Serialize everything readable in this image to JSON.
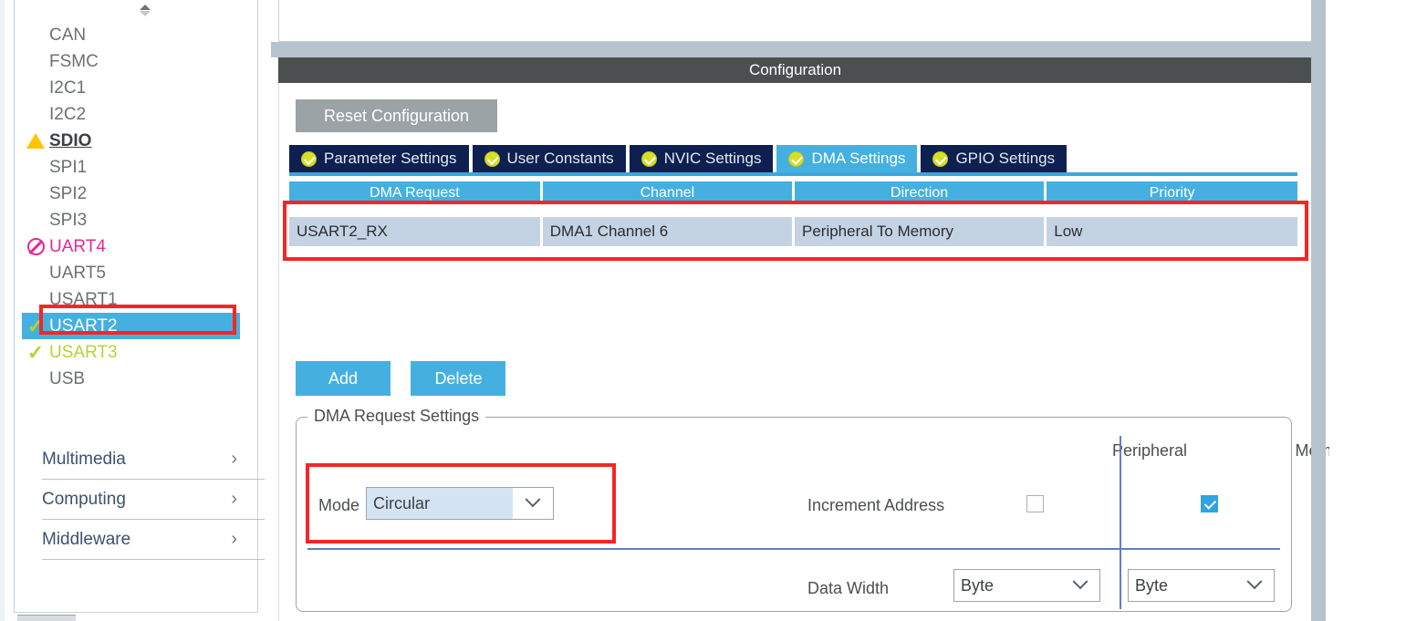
{
  "sidebar": {
    "scroll_spinner": "up-down-spinner",
    "peripherals": [
      {
        "label": "CAN",
        "icon": "none",
        "state": "normal"
      },
      {
        "label": "FSMC",
        "icon": "none",
        "state": "normal"
      },
      {
        "label": "I2C1",
        "icon": "none",
        "state": "normal"
      },
      {
        "label": "I2C2",
        "icon": "none",
        "state": "normal"
      },
      {
        "label": "SDIO",
        "icon": "warning-triangle-icon",
        "state": "warn"
      },
      {
        "label": "SPI1",
        "icon": "none",
        "state": "normal"
      },
      {
        "label": "SPI2",
        "icon": "none",
        "state": "normal"
      },
      {
        "label": "SPI3",
        "icon": "none",
        "state": "normal"
      },
      {
        "label": "UART4",
        "icon": "forbidden-icon",
        "state": "disabled"
      },
      {
        "label": "UART5",
        "icon": "none",
        "state": "normal"
      },
      {
        "label": "USART1",
        "icon": "none",
        "state": "normal"
      },
      {
        "label": "USART2",
        "icon": "check-icon",
        "state": "selected"
      },
      {
        "label": "USART3",
        "icon": "check-icon",
        "state": "enabled"
      },
      {
        "label": "USB",
        "icon": "none",
        "state": "normal"
      }
    ],
    "categories": [
      {
        "label": "Multimedia"
      },
      {
        "label": "Computing"
      },
      {
        "label": "Middleware"
      }
    ]
  },
  "main": {
    "config_header_title": "Configuration",
    "reset_button_label": "Reset Configuration",
    "tabs": [
      {
        "label": "Parameter Settings",
        "active": false
      },
      {
        "label": "User Constants",
        "active": false
      },
      {
        "label": "NVIC Settings",
        "active": false
      },
      {
        "label": "DMA Settings",
        "active": true
      },
      {
        "label": "GPIO Settings",
        "active": false
      }
    ],
    "table": {
      "columns": [
        "DMA Request",
        "Channel",
        "Direction",
        "Priority"
      ],
      "rows": [
        [
          "USART2_RX",
          "DMA1 Channel 6",
          "Peripheral To Memory",
          "Low"
        ]
      ]
    },
    "add_button_label": "Add",
    "delete_button_label": "Delete",
    "group": {
      "legend": "DMA Request Settings",
      "column_peripheral": "Peripheral",
      "column_memory": "Memory",
      "mode_label": "Mode",
      "mode_value": "Circular",
      "increment_address_label": "Increment Address",
      "increment_address_peripheral_checked": false,
      "increment_address_memory_checked": true,
      "data_width_label": "Data Width",
      "data_width_peripheral": "Byte",
      "data_width_memory": "Byte"
    }
  },
  "annotations": {
    "highlight_color": "#f42626",
    "boxes": [
      "usart2-sidebar-item",
      "dma-request-table-row",
      "mode-dropdown"
    ]
  },
  "colors": {
    "accent_blue": "#45b0e0",
    "tab_inactive": "#0d2050",
    "header_gray": "#4c4f50",
    "row_select": "#c4d3e4",
    "warn_yellow": "#ffc400",
    "disabled_magenta": "#e6298f",
    "enabled_green": "#b8d233"
  }
}
